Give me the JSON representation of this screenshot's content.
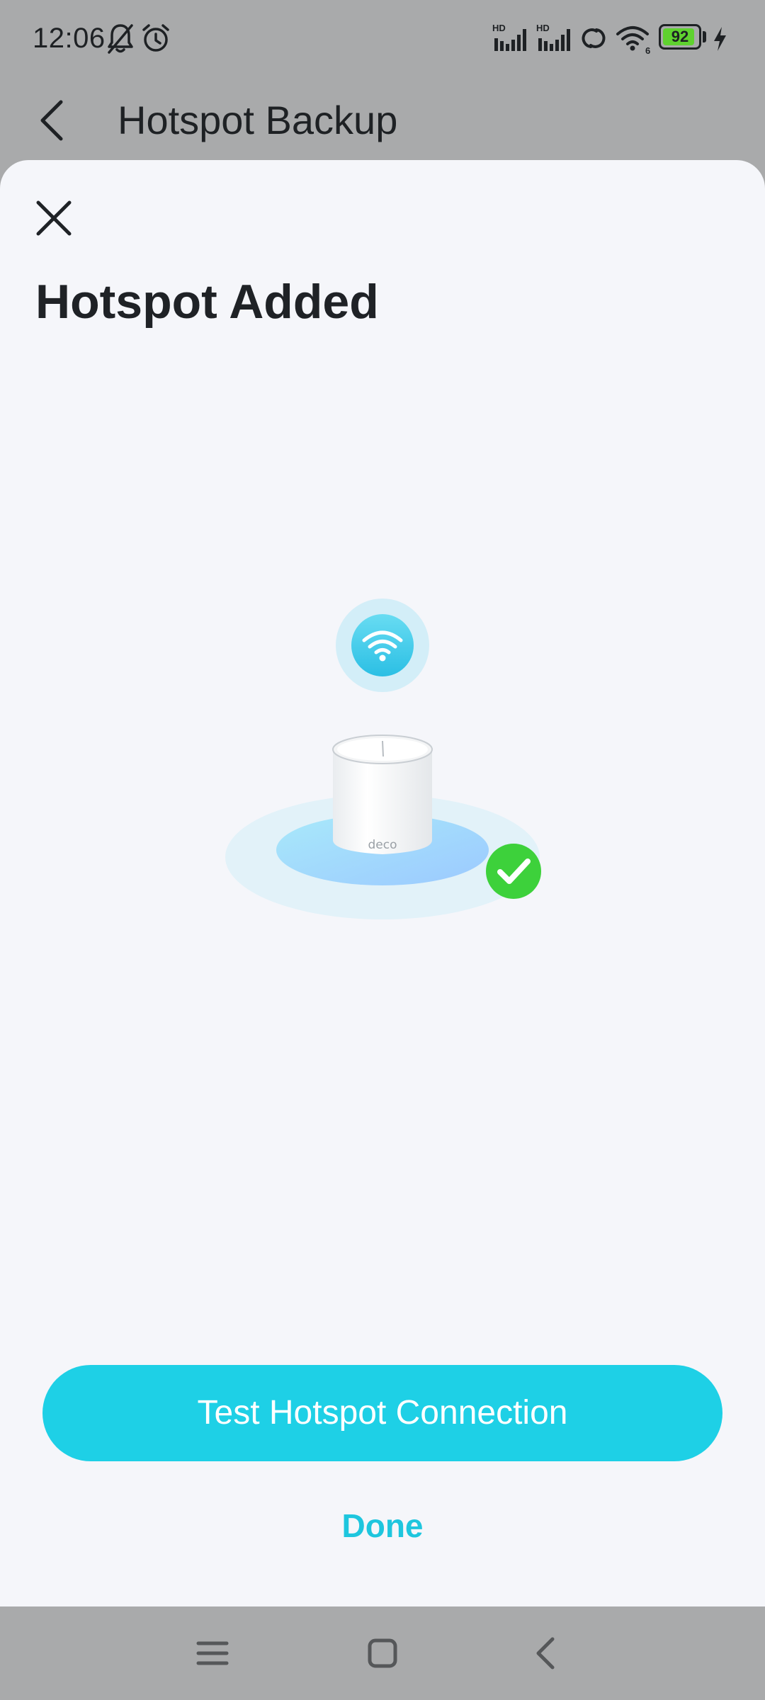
{
  "status_bar": {
    "time": "12:06",
    "battery_level": "92",
    "battery_fraction": 0.92,
    "icons": [
      "bell-off-icon",
      "alarm-icon",
      "signal-hd-1-icon",
      "signal-hd-2-icon",
      "hotspot-link-icon",
      "wifi-6-icon",
      "charging-icon"
    ]
  },
  "app_header": {
    "title": "Hotspot Backup",
    "back_icon": "chevron-left-icon"
  },
  "sheet": {
    "close_icon": "close-icon",
    "title": "Hotspot Added",
    "illustration": {
      "device_label": "deco",
      "icons": [
        "wifi-bubble-icon",
        "check-badge-icon"
      ]
    },
    "primary_button_label": "Test Hotspot Connection",
    "secondary_button_label": "Done"
  },
  "nav_bar": {
    "icons": [
      "menu-icon",
      "home-icon",
      "back-icon"
    ]
  },
  "colors": {
    "accent": "#1ED0E6",
    "accent_text": "#1EC6DE",
    "success": "#3DD13B",
    "scrim": "#A9AAAB",
    "sheet_background": "#F5F6FA",
    "battery_fill": "#5FD22F"
  }
}
